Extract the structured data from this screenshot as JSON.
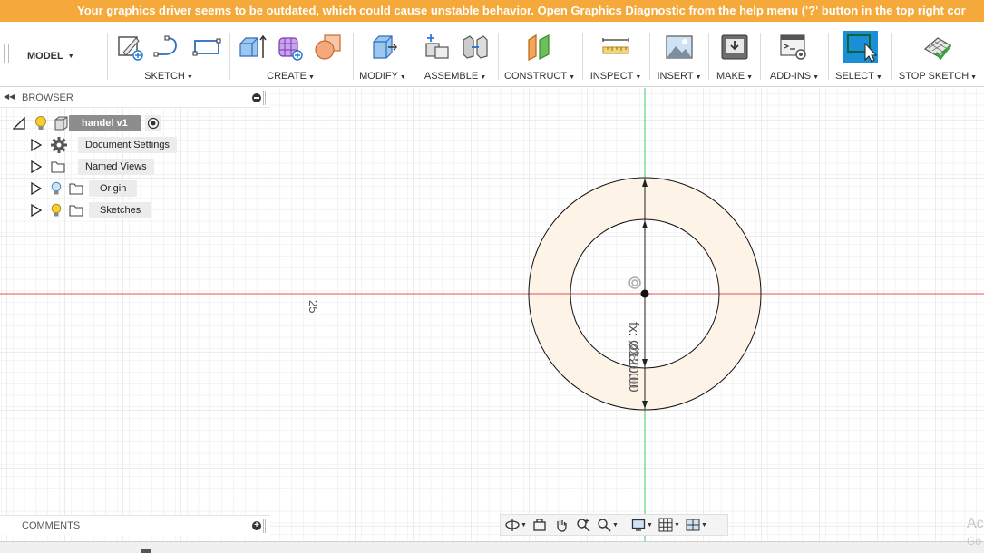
{
  "banner": {
    "message": "Your graphics driver seems to be outdated, which could cause unstable behavior. Open Graphics Diagnostic from the help menu ('?' button in the top right cor"
  },
  "toolbar": {
    "workspace": "MODEL",
    "groups": [
      {
        "label": "SKETCH",
        "icons": [
          "create-sketch-icon",
          "line-icon",
          "rectangle-icon"
        ]
      },
      {
        "label": "CREATE",
        "icons": [
          "extrude-icon",
          "form-icon",
          "combine-icon"
        ]
      },
      {
        "label": "MODIFY",
        "icons": [
          "press-pull-icon"
        ]
      },
      {
        "label": "ASSEMBLE",
        "icons": [
          "new-component-icon",
          "joint-icon"
        ]
      },
      {
        "label": "CONSTRUCT",
        "icons": [
          "offset-plane-icon"
        ]
      },
      {
        "label": "INSPECT",
        "icons": [
          "measure-icon"
        ]
      },
      {
        "label": "INSERT",
        "icons": [
          "insert-image-icon"
        ]
      },
      {
        "label": "MAKE",
        "icons": [
          "3d-print-icon"
        ]
      },
      {
        "label": "ADD-INS",
        "icons": [
          "scripts-icon"
        ]
      },
      {
        "label": "SELECT",
        "icons": [
          "select-icon"
        ]
      },
      {
        "label": "STOP SKETCH",
        "icons": [
          "stop-sketch-icon"
        ]
      }
    ],
    "select_active_color": "#1a8fd6"
  },
  "browser": {
    "title": "BROWSER",
    "root": {
      "label": "handel v1"
    },
    "items": [
      {
        "label": "Document Settings",
        "icon": "gear-icon"
      },
      {
        "label": "Named Views",
        "icon": "folder-icon"
      },
      {
        "label": "Origin",
        "icon": "folder-icon",
        "visibility": "bulb-off"
      },
      {
        "label": "Sketches",
        "icon": "folder-icon",
        "visibility": "bulb-on"
      }
    ]
  },
  "comments": {
    "title": "COMMENTS"
  },
  "canvas": {
    "scale_label": "25",
    "dimension_text": "fx: Ø120.00",
    "dimension_text_2": "Ø80.00",
    "axis_x_color": "#e05050",
    "axis_y_color": "#3cc86a",
    "profile_fill": "#fdf3e6"
  },
  "watermark": {
    "line1": "Ac",
    "line2": "Go"
  }
}
